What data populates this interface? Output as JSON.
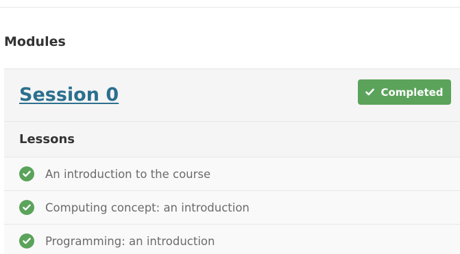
{
  "modules_heading": "Modules",
  "session": {
    "title": "Session 0",
    "status_label": "Completed",
    "status_icon": "check-icon",
    "status_color": "#5ba35b"
  },
  "lessons": {
    "heading": "Lessons",
    "items": [
      {
        "label": "An introduction to the course",
        "status_icon": "check-circle-icon",
        "completed": true
      },
      {
        "label": "Computing concept: an introduction",
        "status_icon": "check-circle-icon",
        "completed": true
      },
      {
        "label": "Programming: an introduction",
        "status_icon": "check-circle-icon",
        "completed": true
      }
    ]
  },
  "colors": {
    "link": "#2b6f8e",
    "success": "#5ba35b",
    "panel_background": "#f5f5f5",
    "text_muted": "#6b6b6b"
  }
}
